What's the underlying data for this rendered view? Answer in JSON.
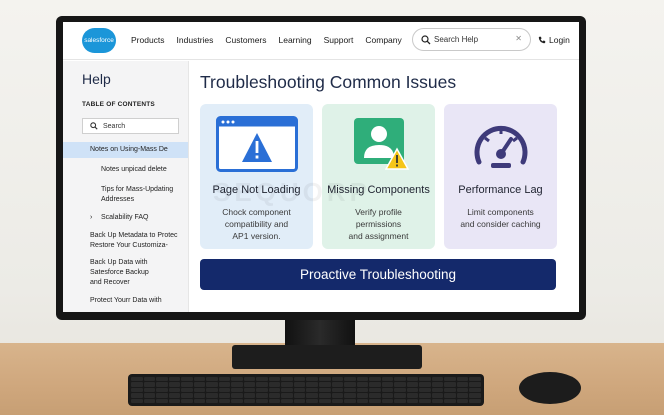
{
  "header": {
    "logo_text": "salesforce",
    "nav": [
      "Products",
      "Industries",
      "Customers",
      "Learning",
      "Support",
      "Company"
    ],
    "search_placeholder": "Search Help",
    "login_label": "Login"
  },
  "sidebar": {
    "title": "Help",
    "toc_heading": "TABLE OF CONTENTS",
    "search_label": "Search",
    "items": [
      "Notes on Using-Mass De",
      "Notes unpicad delete",
      "Tips for Mass-Updating",
      "Addresses",
      "Scalability FAQ",
      "Back Up Metadata to Protec",
      "Restore Your Customiza-",
      "Back Up Data with",
      "Satesforce Backup",
      "and Recover",
      "Protect Yourr Data with"
    ]
  },
  "main": {
    "title": "Troubleshooting Common Issues",
    "watermark": "SEQUORP",
    "cards": [
      {
        "title": "Page Not Loading",
        "desc": "Chock component\ncompatibility and\nAP1 version.",
        "bg": "#e1edf8",
        "icon": "browser-warning-icon"
      },
      {
        "title": "Missing Components",
        "desc": "Verify profile\npermissions\nand assignment",
        "bg": "#dff2e8",
        "icon": "user-warning-icon"
      },
      {
        "title": "Performance Lag",
        "desc": "Limit components\nand consider caching",
        "bg": "#e9e6f6",
        "icon": "speedometer-icon"
      }
    ],
    "cta_label": "Proactive Troubleshooting"
  },
  "colors": {
    "brand_blue": "#1b96d9",
    "navy": "#14296b",
    "warning_yellow": "#f5c518",
    "card_icon_blue": "#2a6fd6",
    "card_icon_green": "#2fae7a",
    "card_icon_purple": "#3e3a7a"
  }
}
